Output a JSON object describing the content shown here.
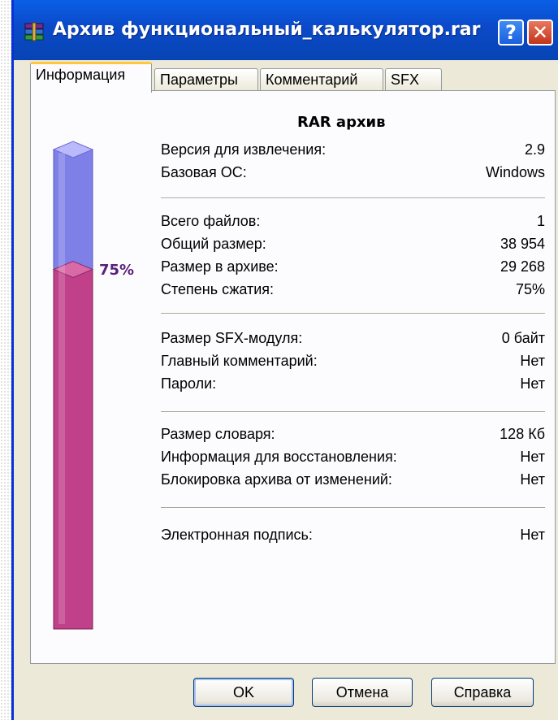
{
  "window": {
    "title": "Архив функциональный_калькулятор.rar",
    "help_label": "?",
    "close_label": "✕"
  },
  "tabs": [
    {
      "label": "Информация",
      "active": true
    },
    {
      "label": "Параметры",
      "active": false
    },
    {
      "label": "Комментарий",
      "active": false
    },
    {
      "label": "SFX",
      "active": false
    }
  ],
  "info": {
    "heading": "RAR архив",
    "compression_percent_label": "75%",
    "compression_ratio": 0.75,
    "groups": [
      [
        {
          "label": "Версия для извлечения:",
          "value": "2.9"
        },
        {
          "label": "Базовая ОС:",
          "value": "Windows"
        }
      ],
      [
        {
          "label": "Всего файлов:",
          "value": "1"
        },
        {
          "label": "Общий размер:",
          "value": "38 954"
        },
        {
          "label": "Размер в архиве:",
          "value": "29 268"
        },
        {
          "label": "Степень сжатия:",
          "value": "75%"
        }
      ],
      [
        {
          "label": "Размер SFX-модуля:",
          "value": "0 байт"
        },
        {
          "label": "Главный комментарий:",
          "value": "Нет"
        },
        {
          "label": "Пароли:",
          "value": "Нет"
        }
      ],
      [
        {
          "label": "Размер словаря:",
          "value": "128 Кб"
        },
        {
          "label": "Информация для восстановления:",
          "value": "Нет"
        },
        {
          "label": "Блокировка архива от изменений:",
          "value": "Нет"
        }
      ],
      [
        {
          "label": "Электронная подпись:",
          "value": "Нет"
        }
      ]
    ]
  },
  "buttons": {
    "ok": "OK",
    "cancel": "Отмена",
    "help": "Справка"
  },
  "colors": {
    "gauge_empty": "#7f7fe8",
    "gauge_fill": "#c0408a",
    "title_bar": "#0b49c8"
  }
}
